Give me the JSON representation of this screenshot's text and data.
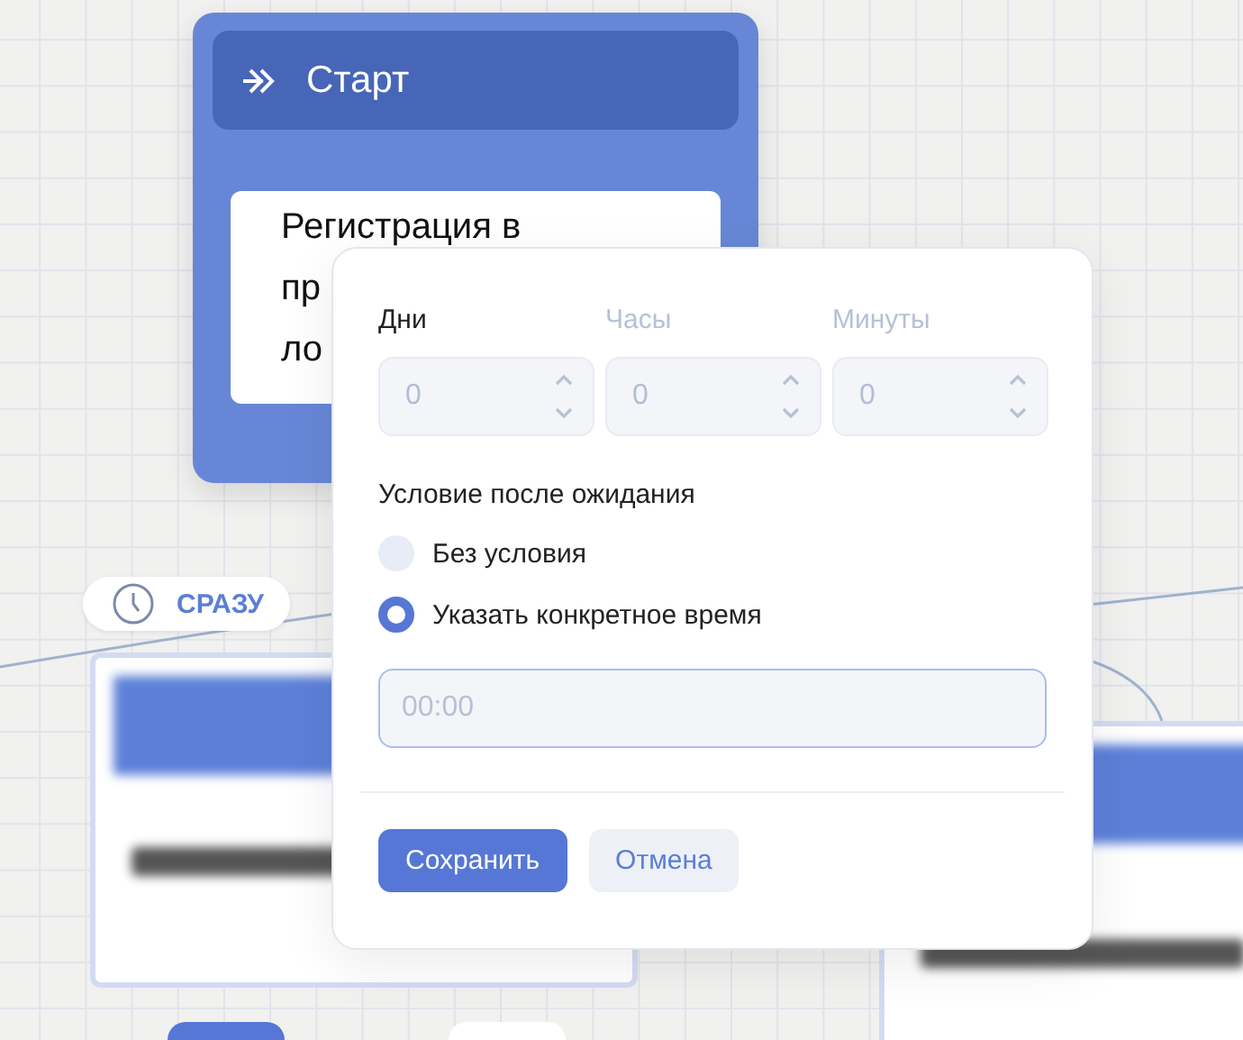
{
  "start_node": {
    "title": "Старт",
    "text_lines": [
      "Регистрация в",
      "пр",
      "ло"
    ]
  },
  "delay_badge": {
    "label": "СРАЗУ"
  },
  "popup": {
    "fields": [
      {
        "label": "Дни",
        "value": "0",
        "disabled": false
      },
      {
        "label": "Часы",
        "value": "0",
        "disabled": true
      },
      {
        "label": "Минуты",
        "value": "0",
        "disabled": true
      }
    ],
    "condition_title": "Условие после ожидания",
    "options": [
      {
        "label": "Без условия",
        "selected": false
      },
      {
        "label": "Указать конкретное время",
        "selected": true
      }
    ],
    "time_input": {
      "placeholder": "00:00"
    },
    "buttons": [
      {
        "label": "Сохранить",
        "kind": "primary"
      },
      {
        "label": "Отмена",
        "kind": "secondary"
      }
    ]
  }
}
